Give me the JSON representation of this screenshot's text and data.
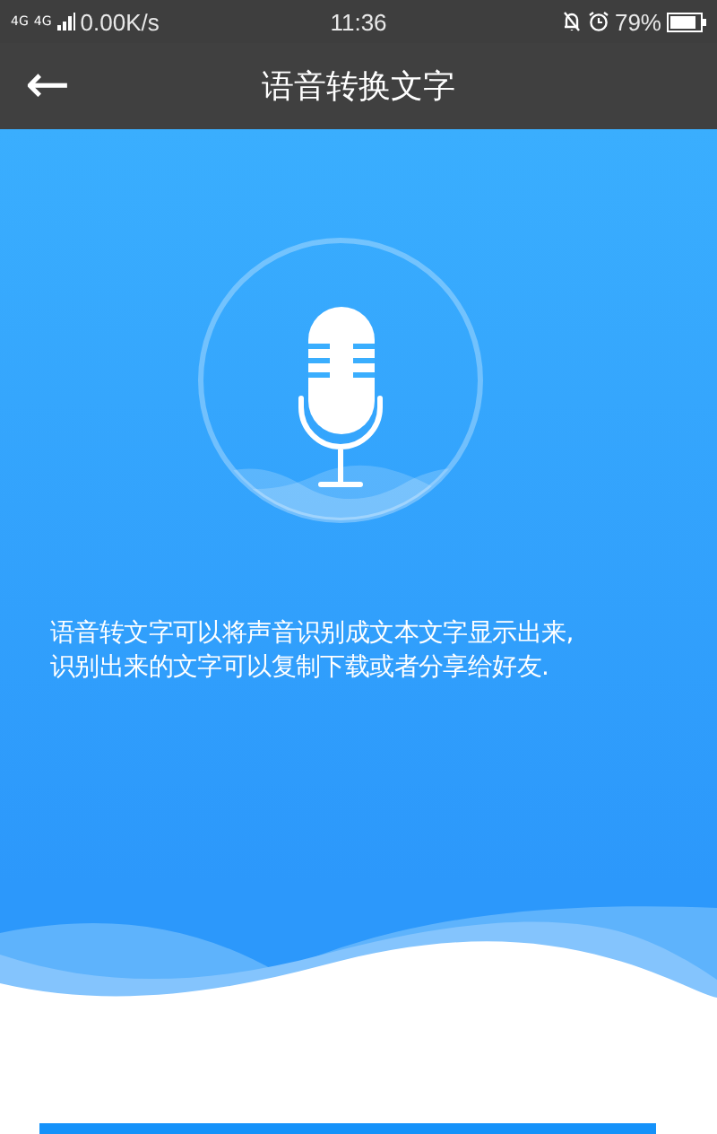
{
  "status_bar": {
    "network_types": [
      "4G",
      "4G"
    ],
    "network_speed": "0.00K/s",
    "time": "11:36",
    "battery": "79%"
  },
  "header": {
    "back": "←",
    "title": "语音转换文字"
  },
  "description": [
    "语音转文字可以将声音识别成文本文字显示出来,",
    "识别出来的文字可以复制下载或者分享给好友."
  ]
}
